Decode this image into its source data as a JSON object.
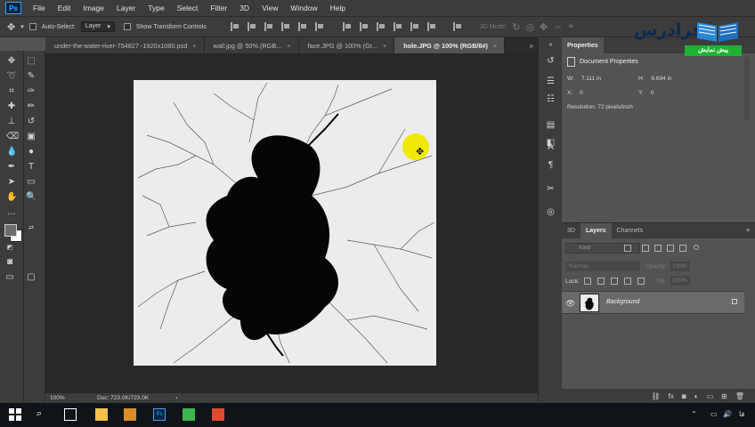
{
  "app": {
    "logo": "Ps"
  },
  "menu": [
    "File",
    "Edit",
    "Image",
    "Layer",
    "Type",
    "Select",
    "Filter",
    "3D",
    "View",
    "Window",
    "Help"
  ],
  "options": {
    "auto_select_label": "Auto-Select:",
    "auto_select_value": "Layer",
    "transform_label": "Show Transform Controls",
    "mode_3d": "3D Mode:"
  },
  "tabs": [
    {
      "label": "under-the-water-river-754827 -1920x1080.psd",
      "close": "×"
    },
    {
      "label": "wall.jpg @ 50% (RGB...",
      "close": "×"
    },
    {
      "label": "face.JPG @ 100% (Gr...",
      "close": "×"
    },
    {
      "label": "hole.JPG @ 100% (RGB/8#)",
      "close": "×"
    }
  ],
  "tab_overflow": "»",
  "status": {
    "zoom": "100%",
    "doc": "Doc: 723.0K/723.0K",
    "arrow": "›"
  },
  "properties": {
    "tab": "Properties",
    "title": "Document Properties",
    "w_label": "W:",
    "w_value": "7.111 in",
    "h_label": "H:",
    "h_value": "6.694 in",
    "x_label": "X:",
    "x_value": "0",
    "y_label": "Y:",
    "y_value": "0",
    "resolution": "Resolution: 72 pixels/inch"
  },
  "layers": {
    "tabs": [
      "3D",
      "Layers",
      "Channels"
    ],
    "kind": "Kind",
    "blend_mode": "Normal",
    "opacity_label": "Opacity:",
    "opacity_value": "100%",
    "lock_label": "Lock:",
    "fill_label": "Fill:",
    "fill_value": "100%",
    "items": [
      {
        "name": "Background",
        "visible": true
      }
    ]
  },
  "watermark": {
    "brand": "فرادرس",
    "sub": "پیش نمایش"
  },
  "taskbar": {
    "lang": "فا"
  },
  "colors": {
    "ps_accent": "#31a8ff",
    "highlight": "#f0ea00",
    "wm_green": "#1db234"
  }
}
